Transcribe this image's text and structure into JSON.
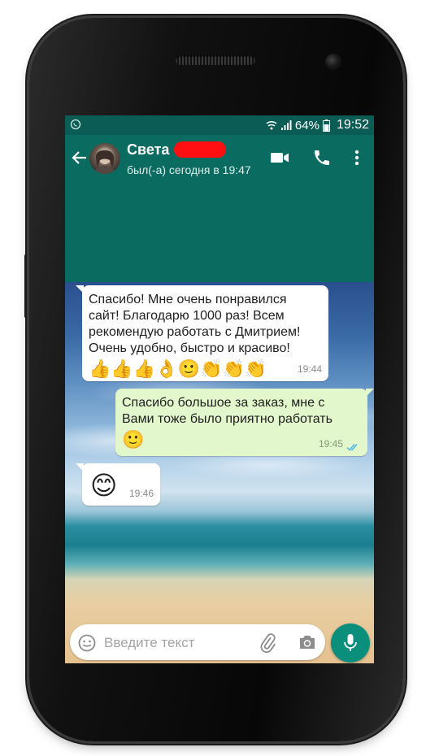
{
  "status_bar": {
    "battery_percent": "64%",
    "clock": "19:52"
  },
  "header": {
    "contact_name": "Света",
    "last_seen": "был(-а) сегодня в 19:47",
    "icons": [
      "back-arrow-icon",
      "video-call-icon",
      "phone-icon",
      "more-vert-icon"
    ]
  },
  "messages": [
    {
      "direction": "incoming",
      "lines": [
        "Спасибо! Мне очень понравился",
        "сайт! Благодарю 1000 раз! Всем",
        "рекомендую работать с Дмитрием!",
        "Очень удобно, быстро и красиво!"
      ],
      "emoji": [
        "👍",
        "👍",
        "👍",
        "👌",
        "🙂",
        "👏",
        "👏",
        "👏"
      ],
      "time": "19:44"
    },
    {
      "direction": "outgoing",
      "lines": [
        "Спасибо большое за заказ, мне с",
        "Вами тоже было приятно работать"
      ],
      "emoji": [
        "🙂"
      ],
      "time": "19:45",
      "read": true
    },
    {
      "direction": "incoming",
      "lines": [],
      "emoji": [
        "😊"
      ],
      "time": "19:46"
    }
  ],
  "composer": {
    "placeholder": "Введите текст",
    "value": ""
  },
  "colors": {
    "header_bg": "#0a6b61",
    "status_bg": "#0a5c54",
    "outgoing_bubble": "#e2f7cb",
    "fab": "#0a8f7c",
    "ticks": "#4fb6ec",
    "redaction": "#ff0f12"
  }
}
